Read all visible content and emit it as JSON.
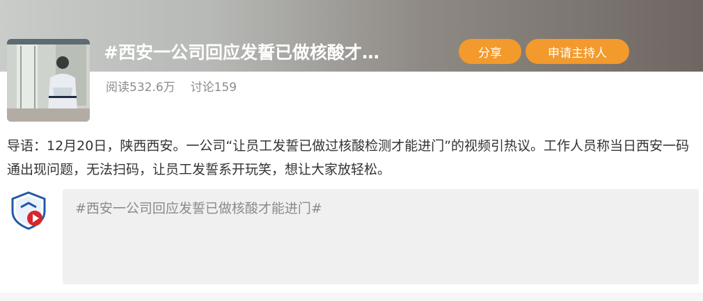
{
  "topic": {
    "title": "#西安一公司回应发誓已做核酸才…",
    "share_label": "分享",
    "apply_host_label": "申请主持人",
    "reads": "阅读532.6万",
    "discussions": "讨论159"
  },
  "intro": {
    "text": "导语：12月20日，陕西西安。一公司“让员工发誓已做过核酸检测才能进门”的视频引热议。工作人员称当日西安一码通出现问题，无法扫码，让员工发誓系开玩笑，想让大家放轻松。"
  },
  "post_input": {
    "value": "#西安一公司回应发誓已做核酸才能进门#"
  },
  "colors": {
    "accent": "#f39a2c",
    "badge_blue": "#1f5aa8",
    "badge_red": "#d7262b"
  },
  "icons": {
    "video_badge": "shield-play-icon"
  }
}
